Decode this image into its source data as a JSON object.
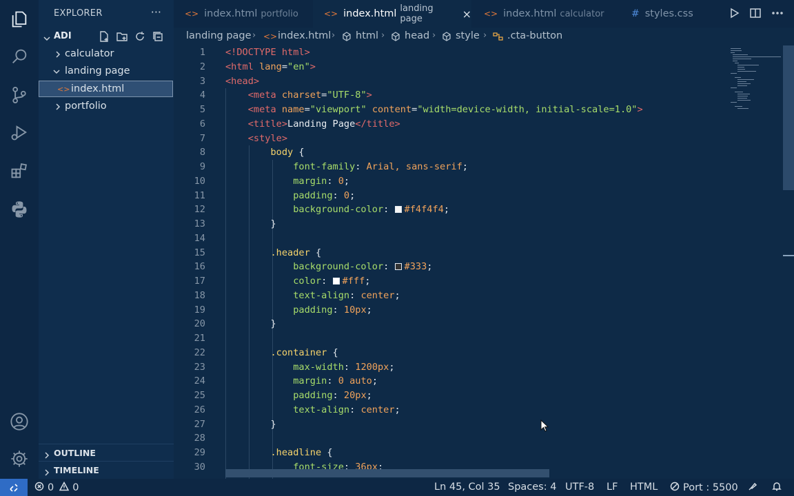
{
  "sidebar": {
    "title": "EXPLORER",
    "more": "···",
    "folder": "ADI",
    "items": [
      {
        "label": "calculator",
        "expanded": false
      },
      {
        "label": "landing page",
        "expanded": true
      },
      {
        "label": "index.html",
        "selected": true
      },
      {
        "label": "portfolio",
        "expanded": false
      }
    ],
    "file_icon": "<>",
    "outline": "OUTLINE",
    "timeline": "TIMELINE"
  },
  "tabs": [
    {
      "name": "index.html",
      "desc": "portfolio",
      "icon": "<>",
      "active": false
    },
    {
      "name": "index.html",
      "desc": "landing page",
      "icon": "<>",
      "active": true,
      "close": "×"
    },
    {
      "name": "index.html",
      "desc": "calculator",
      "icon": "<>",
      "active": false
    },
    {
      "name": "styles.css",
      "desc": "",
      "icon": "#",
      "active": false
    }
  ],
  "breadcrumb": [
    "landing page",
    "index.html",
    "html",
    "head",
    "style",
    ".cta-button"
  ],
  "code_lines": [
    {
      "n": "1",
      "tokens": [
        [
          "t-tag",
          "<!DOCTYPE html>"
        ]
      ]
    },
    {
      "n": "2",
      "tokens": [
        [
          "t-tag",
          "<html "
        ],
        [
          "t-attr",
          "lang"
        ],
        [
          "t-plain",
          "="
        ],
        [
          "t-str",
          "\"en\""
        ],
        [
          "t-tag",
          ">"
        ]
      ]
    },
    {
      "n": "3",
      "tokens": [
        [
          "t-tag",
          "<head>"
        ]
      ]
    },
    {
      "n": "4",
      "tokens": [
        [
          "t-plain",
          "    "
        ],
        [
          "t-tag",
          "<meta "
        ],
        [
          "t-attr",
          "charset"
        ],
        [
          "t-plain",
          "="
        ],
        [
          "t-str",
          "\"UTF-8\""
        ],
        [
          "t-tag",
          ">"
        ]
      ]
    },
    {
      "n": "5",
      "tokens": [
        [
          "t-plain",
          "    "
        ],
        [
          "t-tag",
          "<meta "
        ],
        [
          "t-attr",
          "name"
        ],
        [
          "t-plain",
          "="
        ],
        [
          "t-str",
          "\"viewport\""
        ],
        [
          "t-plain",
          " "
        ],
        [
          "t-attr",
          "content"
        ],
        [
          "t-plain",
          "="
        ],
        [
          "t-str",
          "\"width=device-width, initial-scale=1.0\""
        ],
        [
          "t-tag",
          ">"
        ]
      ]
    },
    {
      "n": "6",
      "tokens": [
        [
          "t-plain",
          "    "
        ],
        [
          "t-tag",
          "<title>"
        ],
        [
          "t-text",
          "Landing Page"
        ],
        [
          "t-tag",
          "</title>"
        ]
      ]
    },
    {
      "n": "7",
      "tokens": [
        [
          "t-plain",
          "    "
        ],
        [
          "t-tag",
          "<style>"
        ]
      ]
    },
    {
      "n": "8",
      "tokens": [
        [
          "t-plain",
          "        "
        ],
        [
          "t-sel",
          "body"
        ],
        [
          "t-plain",
          " {"
        ]
      ]
    },
    {
      "n": "9",
      "tokens": [
        [
          "t-plain",
          "            "
        ],
        [
          "t-prop",
          "font-family"
        ],
        [
          "t-plain",
          ": "
        ],
        [
          "t-val",
          "Arial, sans-serif"
        ],
        [
          "t-plain",
          ";"
        ]
      ]
    },
    {
      "n": "10",
      "tokens": [
        [
          "t-plain",
          "            "
        ],
        [
          "t-prop",
          "margin"
        ],
        [
          "t-plain",
          ": "
        ],
        [
          "t-num",
          "0"
        ],
        [
          "t-plain",
          ";"
        ]
      ]
    },
    {
      "n": "11",
      "tokens": [
        [
          "t-plain",
          "            "
        ],
        [
          "t-prop",
          "padding"
        ],
        [
          "t-plain",
          ": "
        ],
        [
          "t-num",
          "0"
        ],
        [
          "t-plain",
          ";"
        ]
      ]
    },
    {
      "n": "12",
      "tokens": [
        [
          "t-plain",
          "            "
        ],
        [
          "t-prop",
          "background-color"
        ],
        [
          "t-plain",
          ": "
        ],
        [
          "swatch",
          "#f4f4f4"
        ],
        [
          "t-val",
          "#f4f4f4"
        ],
        [
          "t-plain",
          ";"
        ]
      ]
    },
    {
      "n": "13",
      "tokens": [
        [
          "t-plain",
          "        }"
        ]
      ]
    },
    {
      "n": "14",
      "tokens": []
    },
    {
      "n": "15",
      "tokens": [
        [
          "t-plain",
          "        "
        ],
        [
          "t-sel",
          ".header"
        ],
        [
          "t-plain",
          " {"
        ]
      ]
    },
    {
      "n": "16",
      "tokens": [
        [
          "t-plain",
          "            "
        ],
        [
          "t-prop",
          "background-color"
        ],
        [
          "t-plain",
          ": "
        ],
        [
          "swatch",
          "#333"
        ],
        [
          "t-val",
          "#333"
        ],
        [
          "t-plain",
          ";"
        ]
      ]
    },
    {
      "n": "17",
      "tokens": [
        [
          "t-plain",
          "            "
        ],
        [
          "t-prop",
          "color"
        ],
        [
          "t-plain",
          ": "
        ],
        [
          "swatch",
          "#fff"
        ],
        [
          "t-val",
          "#fff"
        ],
        [
          "t-plain",
          ";"
        ]
      ]
    },
    {
      "n": "18",
      "tokens": [
        [
          "t-plain",
          "            "
        ],
        [
          "t-prop",
          "text-align"
        ],
        [
          "t-plain",
          ": "
        ],
        [
          "t-val",
          "center"
        ],
        [
          "t-plain",
          ";"
        ]
      ]
    },
    {
      "n": "19",
      "tokens": [
        [
          "t-plain",
          "            "
        ],
        [
          "t-prop",
          "padding"
        ],
        [
          "t-plain",
          ": "
        ],
        [
          "t-num",
          "10px"
        ],
        [
          "t-plain",
          ";"
        ]
      ]
    },
    {
      "n": "20",
      "tokens": [
        [
          "t-plain",
          "        }"
        ]
      ]
    },
    {
      "n": "21",
      "tokens": []
    },
    {
      "n": "22",
      "tokens": [
        [
          "t-plain",
          "        "
        ],
        [
          "t-sel",
          ".container"
        ],
        [
          "t-plain",
          " {"
        ]
      ]
    },
    {
      "n": "23",
      "tokens": [
        [
          "t-plain",
          "            "
        ],
        [
          "t-prop",
          "max-width"
        ],
        [
          "t-plain",
          ": "
        ],
        [
          "t-num",
          "1200px"
        ],
        [
          "t-plain",
          ";"
        ]
      ]
    },
    {
      "n": "24",
      "tokens": [
        [
          "t-plain",
          "            "
        ],
        [
          "t-prop",
          "margin"
        ],
        [
          "t-plain",
          ": "
        ],
        [
          "t-num",
          "0 auto"
        ],
        [
          "t-plain",
          ";"
        ]
      ]
    },
    {
      "n": "25",
      "tokens": [
        [
          "t-plain",
          "            "
        ],
        [
          "t-prop",
          "padding"
        ],
        [
          "t-plain",
          ": "
        ],
        [
          "t-num",
          "20px"
        ],
        [
          "t-plain",
          ";"
        ]
      ]
    },
    {
      "n": "26",
      "tokens": [
        [
          "t-plain",
          "            "
        ],
        [
          "t-prop",
          "text-align"
        ],
        [
          "t-plain",
          ": "
        ],
        [
          "t-val",
          "center"
        ],
        [
          "t-plain",
          ";"
        ]
      ]
    },
    {
      "n": "27",
      "tokens": [
        [
          "t-plain",
          "        }"
        ]
      ]
    },
    {
      "n": "28",
      "tokens": []
    },
    {
      "n": "29",
      "tokens": [
        [
          "t-plain",
          "        "
        ],
        [
          "t-sel",
          ".headline"
        ],
        [
          "t-plain",
          " {"
        ]
      ]
    },
    {
      "n": "30",
      "tokens": [
        [
          "t-plain",
          "            "
        ],
        [
          "t-prop",
          "font-size"
        ],
        [
          "t-plain",
          ": "
        ],
        [
          "t-num",
          "36px"
        ],
        [
          "t-plain",
          ";"
        ]
      ]
    }
  ],
  "status": {
    "errors": "0",
    "warnings": "0",
    "position": "Ln 45, Col 35",
    "spaces": "Spaces: 4",
    "encoding": "UTF-8",
    "eol": "LF",
    "language": "HTML",
    "port": "Port : 5500"
  },
  "colors": {
    "background": "#0e2a47",
    "activity_bar": "#0d2744",
    "sidebar": "#0f2d4d",
    "accent": "#2f6cc5",
    "html_icon": "#e1793b",
    "css_icon": "#4e8ad9"
  }
}
